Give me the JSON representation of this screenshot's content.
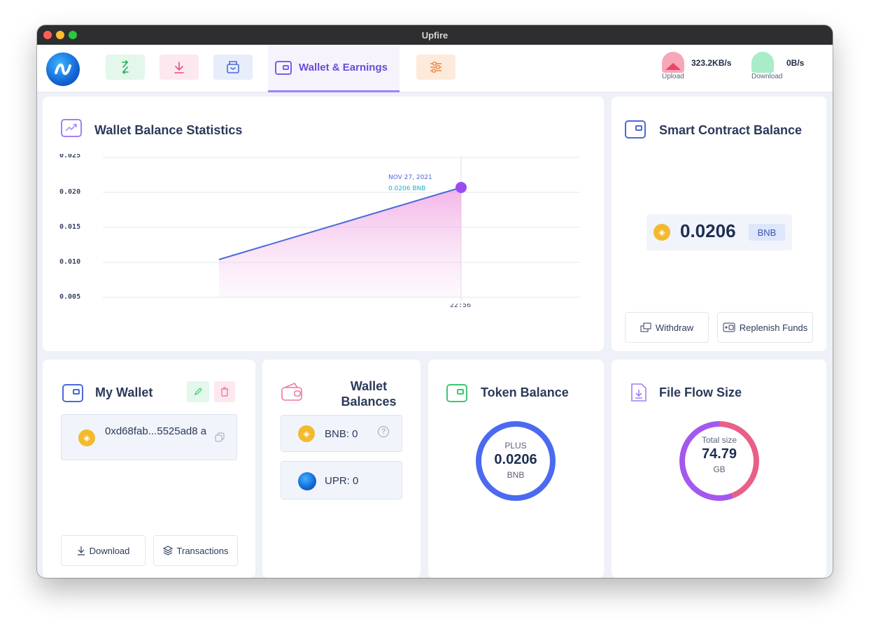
{
  "window": {
    "title": "Upfire"
  },
  "nav": {
    "active_tab_label": "Wallet & Earnings"
  },
  "speed": {
    "upload_value": "323.2KB/s",
    "upload_label": "Upload",
    "download_value": "0B/s",
    "download_label": "Download"
  },
  "stats": {
    "title": "Wallet Balance Statistics",
    "tooltip_date": "NOV 27, 2021",
    "tooltip_value": "0.0206 BNB",
    "chart_data": {
      "type": "area",
      "y_ticks": [
        "0.025",
        "0.020",
        "0.015",
        "0.010",
        "0.005"
      ],
      "x_tick": "22:56",
      "ylim": [
        0.005,
        0.025
      ],
      "points": [
        {
          "y": 0.0104
        },
        {
          "x": "22:56",
          "y": 0.0206
        }
      ],
      "grid": true
    }
  },
  "smart_contract": {
    "title": "Smart Contract Balance",
    "amount": "0.0206",
    "unit": "BNB",
    "withdraw_label": "Withdraw",
    "replenish_label": "Replenish Funds"
  },
  "my_wallet": {
    "title": "My Wallet",
    "address": "0xd68fab...5525ad8 a",
    "download_label": "Download",
    "transactions_label": "Transactions"
  },
  "wallet_balances": {
    "title_line1": "Wallet",
    "title_line2": "Balances",
    "bnb": "BNB: 0",
    "upr": "UPR: 0"
  },
  "token_balance": {
    "title": "Token Balance",
    "plus_label": "PLUS",
    "amount": "0.0206",
    "unit": "BNB",
    "ring_color": "#4b6af0"
  },
  "file_flow": {
    "title": "File Flow Size",
    "total_label": "Total size",
    "amount": "74.79",
    "unit": "GB"
  }
}
